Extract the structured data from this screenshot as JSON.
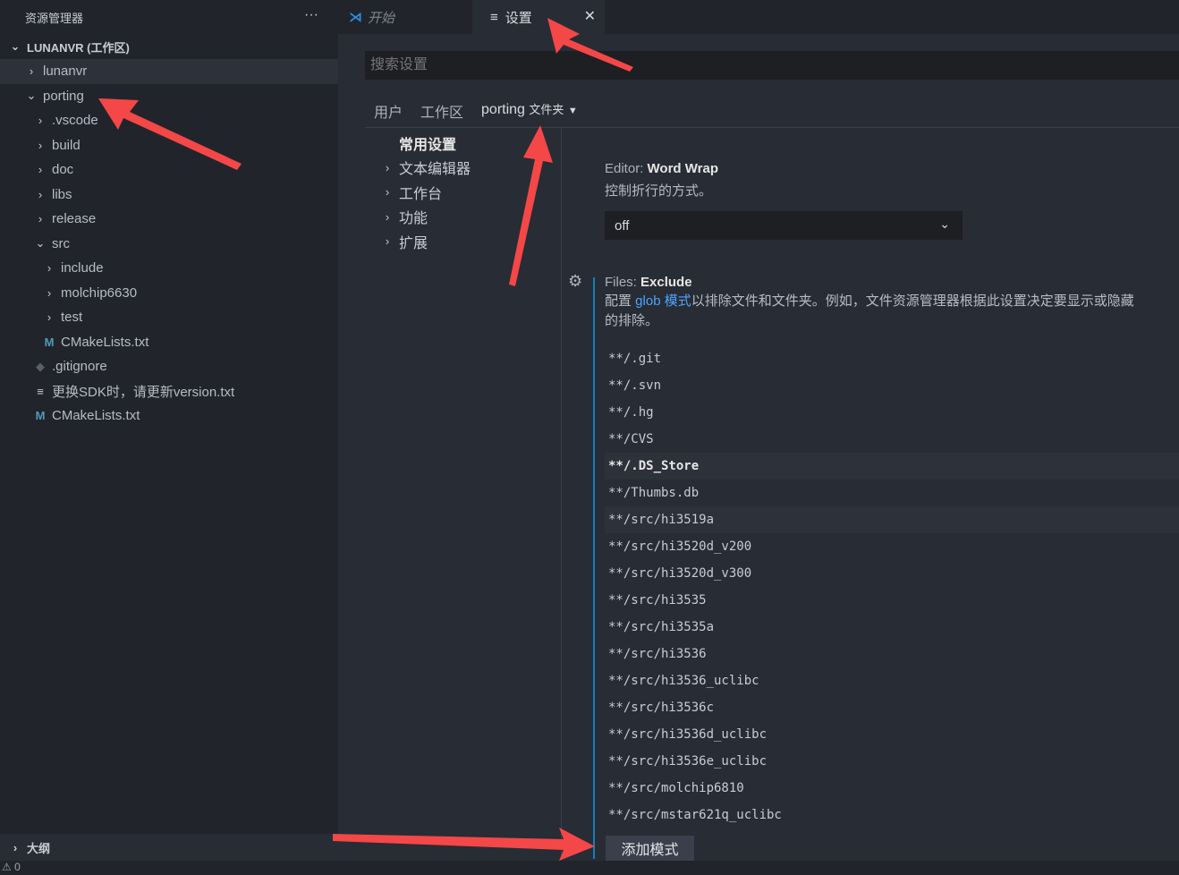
{
  "sidebar": {
    "title": "资源管理器",
    "more": "···",
    "workspace": "LUNANVR (工作区)",
    "tree": [
      {
        "label": "lunanvr",
        "chev": "›",
        "indent": 28,
        "sel": true
      },
      {
        "label": "porting",
        "chev": "⌄",
        "indent": 28
      },
      {
        "label": ".vscode",
        "chev": "›",
        "indent": 38
      },
      {
        "label": "build",
        "chev": "›",
        "indent": 38
      },
      {
        "label": "doc",
        "chev": "›",
        "indent": 38
      },
      {
        "label": "libs",
        "chev": "›",
        "indent": 38
      },
      {
        "label": "release",
        "chev": "›",
        "indent": 38
      },
      {
        "label": "src",
        "chev": "⌄",
        "indent": 38
      },
      {
        "label": "include",
        "chev": "›",
        "indent": 48
      },
      {
        "label": "molchip6630",
        "chev": "›",
        "indent": 48
      },
      {
        "label": "test",
        "chev": "›",
        "indent": 48
      },
      {
        "label": "CMakeLists.txt",
        "icon": "M",
        "indent": 48
      },
      {
        "label": ".gitignore",
        "icon": "◆",
        "indent": 38
      },
      {
        "label": "更换SDK时，请更新version.txt",
        "icon": "≡",
        "indent": 38
      },
      {
        "label": "CMakeLists.txt",
        "icon": "M",
        "indent": 38
      }
    ],
    "outline": "大纲"
  },
  "status": {
    "warnings": "⚠ 0"
  },
  "tabs": [
    {
      "label": "开始"
    },
    {
      "label": "设置",
      "close": "✕"
    }
  ],
  "settings": {
    "search_placeholder": "搜索设置",
    "scopes": [
      "用户",
      "工作区",
      "porting"
    ],
    "folder_label": "文件夹",
    "toc": [
      {
        "label": "常用设置",
        "chev": ""
      },
      {
        "label": "文本编辑器",
        "chev": "›"
      },
      {
        "label": "工作台",
        "chev": "›"
      },
      {
        "label": "功能",
        "chev": "›"
      },
      {
        "label": "扩展",
        "chev": "›"
      }
    ],
    "word_wrap": {
      "category": "Editor: ",
      "name": "Word Wrap",
      "desc": "控制折行的方式。",
      "value": "off"
    },
    "exclude": {
      "category": "Files: ",
      "name": "Exclude",
      "desc_pre": "配置 ",
      "link": "glob 模式",
      "desc_post": "以排除文件和文件夹。例如，文件资源管理器根据此设置决定要显示或隐藏",
      "desc_line2": "的排除。",
      "patterns": [
        "**/.git",
        "**/.svn",
        "**/.hg",
        "**/CVS",
        "**/.DS_Store",
        "**/Thumbs.db",
        "**/src/hi3519a",
        "**/src/hi3520d_v200",
        "**/src/hi3520d_v300",
        "**/src/hi3535",
        "**/src/hi3535a",
        "**/src/hi3536",
        "**/src/hi3536_uclibc",
        "**/src/hi3536c",
        "**/src/hi3536d_uclibc",
        "**/src/hi3536e_uclibc",
        "**/src/molchip6810",
        "**/src/mstar621q_uclibc"
      ],
      "add_button": "添加模式"
    }
  },
  "colors": {
    "accent": "#1a7fb8",
    "link": "#4ca3ff",
    "annotation_arrow": "#f44747"
  }
}
